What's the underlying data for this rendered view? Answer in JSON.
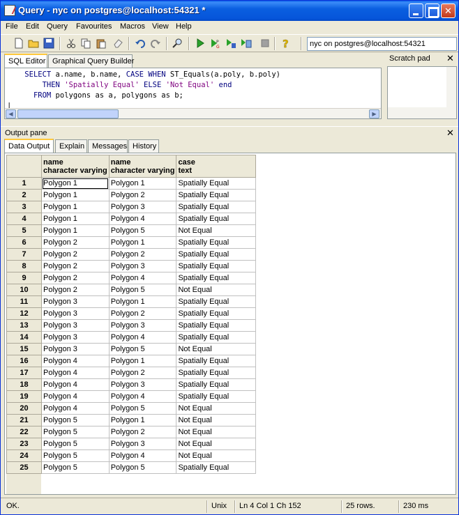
{
  "window": {
    "title": "Query - nyc on postgres@localhost:54321 *"
  },
  "menu": {
    "items": [
      "File",
      "Edit",
      "Query",
      "Favourites",
      "Macros",
      "View",
      "Help"
    ]
  },
  "toolbar": {
    "connection": "nyc on postgres@localhost:54321",
    "icons": [
      "new-file-icon",
      "open-folder-icon",
      "save-icon",
      "cut-icon",
      "copy-icon",
      "paste-icon",
      "eraser-icon",
      "undo-icon",
      "redo-icon",
      "find-icon",
      "execute-icon",
      "execute-pgscript-icon",
      "execute-to-file-icon",
      "explain-icon",
      "stop-icon",
      "help-icon"
    ]
  },
  "editor": {
    "tabs": [
      "SQL Editor",
      "Graphical Query Builder"
    ],
    "active_tab": "SQL Editor",
    "sql": {
      "line1_kw1": "SELECT",
      "line1_rest": " a.name, b.name, ",
      "line1_kw2": "CASE WHEN",
      "line1_rest2": " ST_Equals(a.poly, b.poly)",
      "line2_kw1": "THEN",
      "line2_str1": "'Spatially Equal'",
      "line2_kw2": "ELSE",
      "line2_str2": "'Not Equal'",
      "line2_kw3": "end",
      "line3_kw1": "FROM",
      "line3_rest": " polygons as a, polygons as b;"
    }
  },
  "scratch_pad": {
    "label": "Scratch pad",
    "close": "✕"
  },
  "output_pane": {
    "label": "Output pane",
    "close": "✕",
    "tabs": [
      "Data Output",
      "Explain",
      "Messages",
      "History"
    ],
    "active_tab": "Data Output",
    "columns": [
      {
        "name": "name",
        "type": "character varying"
      },
      {
        "name": "name",
        "type": "character varying"
      },
      {
        "name": "case",
        "type": "text"
      }
    ],
    "rows": [
      [
        "Polygon 1",
        "Polygon 1",
        "Spatially Equal"
      ],
      [
        "Polygon 1",
        "Polygon 2",
        "Spatially Equal"
      ],
      [
        "Polygon 1",
        "Polygon 3",
        "Spatially Equal"
      ],
      [
        "Polygon 1",
        "Polygon 4",
        "Spatially Equal"
      ],
      [
        "Polygon 1",
        "Polygon 5",
        "Not Equal"
      ],
      [
        "Polygon 2",
        "Polygon 1",
        "Spatially Equal"
      ],
      [
        "Polygon 2",
        "Polygon 2",
        "Spatially Equal"
      ],
      [
        "Polygon 2",
        "Polygon 3",
        "Spatially Equal"
      ],
      [
        "Polygon 2",
        "Polygon 4",
        "Spatially Equal"
      ],
      [
        "Polygon 2",
        "Polygon 5",
        "Not Equal"
      ],
      [
        "Polygon 3",
        "Polygon 1",
        "Spatially Equal"
      ],
      [
        "Polygon 3",
        "Polygon 2",
        "Spatially Equal"
      ],
      [
        "Polygon 3",
        "Polygon 3",
        "Spatially Equal"
      ],
      [
        "Polygon 3",
        "Polygon 4",
        "Spatially Equal"
      ],
      [
        "Polygon 3",
        "Polygon 5",
        "Not Equal"
      ],
      [
        "Polygon 4",
        "Polygon 1",
        "Spatially Equal"
      ],
      [
        "Polygon 4",
        "Polygon 2",
        "Spatially Equal"
      ],
      [
        "Polygon 4",
        "Polygon 3",
        "Spatially Equal"
      ],
      [
        "Polygon 4",
        "Polygon 4",
        "Spatially Equal"
      ],
      [
        "Polygon 4",
        "Polygon 5",
        "Not Equal"
      ],
      [
        "Polygon 5",
        "Polygon 1",
        "Not Equal"
      ],
      [
        "Polygon 5",
        "Polygon 2",
        "Not Equal"
      ],
      [
        "Polygon 5",
        "Polygon 3",
        "Not Equal"
      ],
      [
        "Polygon 5",
        "Polygon 4",
        "Not Equal"
      ],
      [
        "Polygon 5",
        "Polygon 5",
        "Spatially Equal"
      ]
    ]
  },
  "status": {
    "message": "OK.",
    "line_endings": "Unix",
    "cursor": "Ln 4 Col 1 Ch 152",
    "row_count": "25 rows.",
    "elapsed": "230 ms"
  },
  "colors": {
    "title_bar": "#0a5fe0",
    "sql_keyword": "#00007f",
    "sql_string": "#7f007f"
  }
}
